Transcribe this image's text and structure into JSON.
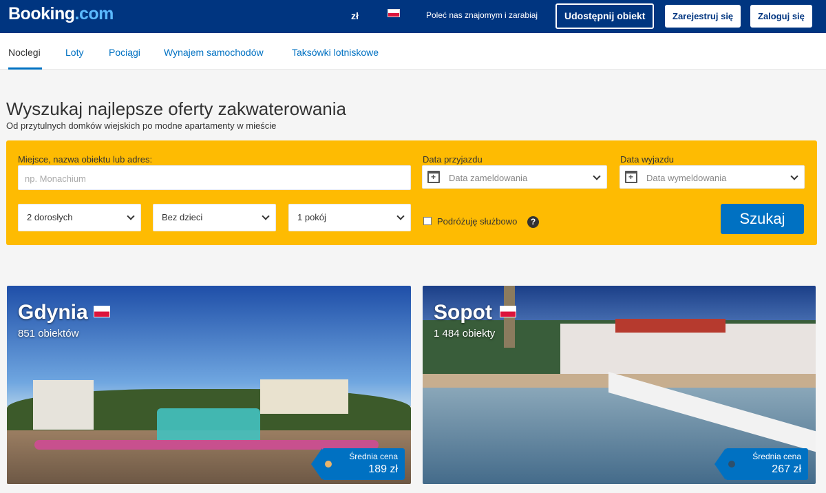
{
  "header": {
    "logo_main": "Booking",
    "logo_dot": ".com",
    "currency": "zł",
    "refer": "Poleć nas znajomym i zarabiaj",
    "list_property": "Udostępnij obiekt",
    "register": "Zarejestruj się",
    "login": "Zaloguj się"
  },
  "nav": {
    "items": [
      "Noclegi",
      "Loty",
      "Pociągi",
      "Wynajem samochodów",
      "Taksówki lotniskowe"
    ]
  },
  "hero": {
    "title": "Wyszukaj najlepsze oferty zakwaterowania",
    "subtitle": "Od przytulnych domków wiejskich po modne apartamenty w mieście"
  },
  "search": {
    "destination_label": "Miejsce, nazwa obiektu lub adres:",
    "destination_placeholder": "np. Monachium",
    "checkin_label": "Data przyjazdu",
    "checkin_placeholder": "Data zameldowania",
    "checkout_label": "Data wyjazdu",
    "checkout_placeholder": "Data wymeldowania",
    "adults": "2 dorosłych",
    "children": "Bez dzieci",
    "rooms": "1 pokój",
    "business_label": "Podróżuję służbowo",
    "help": "?",
    "submit": "Szukaj"
  },
  "destinations": [
    {
      "name": "Gdynia",
      "count": "851 obiektów",
      "price_label": "Średnia cena",
      "price": "189 zł"
    },
    {
      "name": "Sopot",
      "count": "1 484 obiekty",
      "price_label": "Średnia cena",
      "price": "267 zł"
    }
  ],
  "colors": {
    "brand_dark": "#003580",
    "brand_blue": "#0071c2",
    "search_yellow": "#febb02"
  }
}
